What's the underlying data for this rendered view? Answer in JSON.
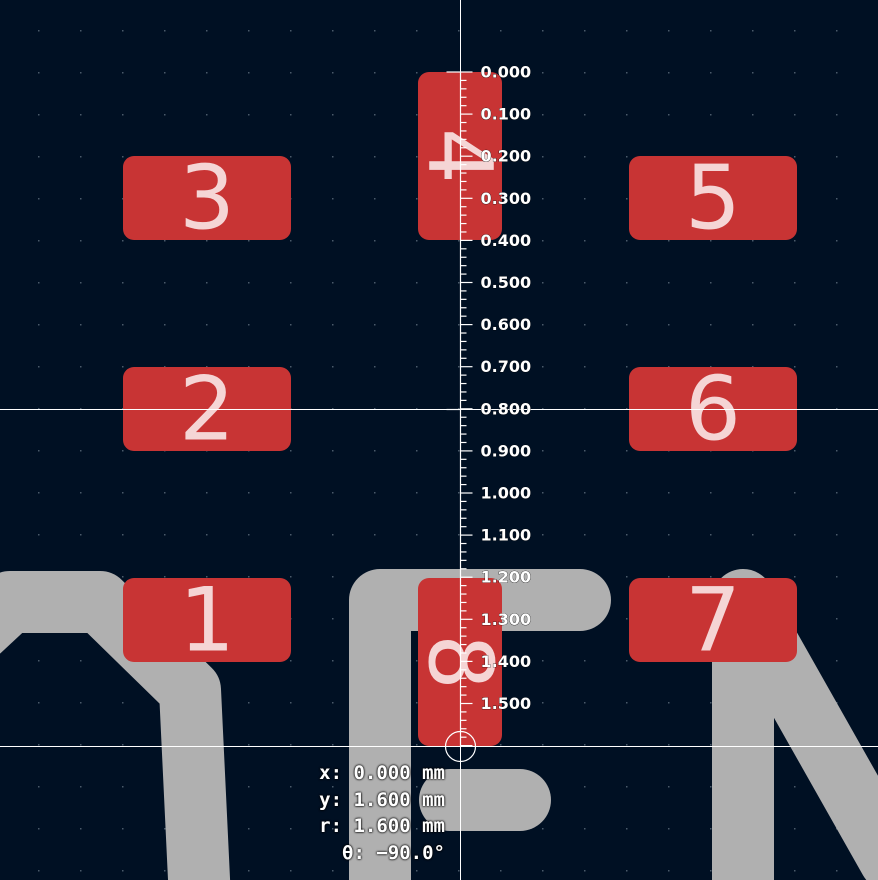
{
  "pads": [
    {
      "id": "pad-1",
      "label": "1"
    },
    {
      "id": "pad-2",
      "label": "2"
    },
    {
      "id": "pad-3",
      "label": "3"
    },
    {
      "id": "pad-4",
      "label": "4"
    },
    {
      "id": "pad-5",
      "label": "5"
    },
    {
      "id": "pad-6",
      "label": "6"
    },
    {
      "id": "pad-7",
      "label": "7"
    },
    {
      "id": "pad-8",
      "label": "8"
    }
  ],
  "ruler": {
    "unit": "mm",
    "tick_labels": [
      "0.000",
      "0.100",
      "0.200",
      "0.300",
      "0.400",
      "0.500",
      "0.600",
      "0.700",
      "0.800",
      "0.900",
      "1.000",
      "1.100",
      "1.200",
      "1.300",
      "1.400",
      "1.500"
    ]
  },
  "readout": {
    "x": "x: 0.000 mm",
    "y": "y: 1.600 mm",
    "r": "r: 1.600 mm",
    "theta": "θ: −90.0°"
  },
  "colors": {
    "background": "#001023",
    "pad": "#c83434",
    "pad_text": "#f5d5d5",
    "trace": "#b0b0b0",
    "grid_dot": "#4a5a6a",
    "crosshair": "#ffffff",
    "ruler": "#ffffff"
  }
}
